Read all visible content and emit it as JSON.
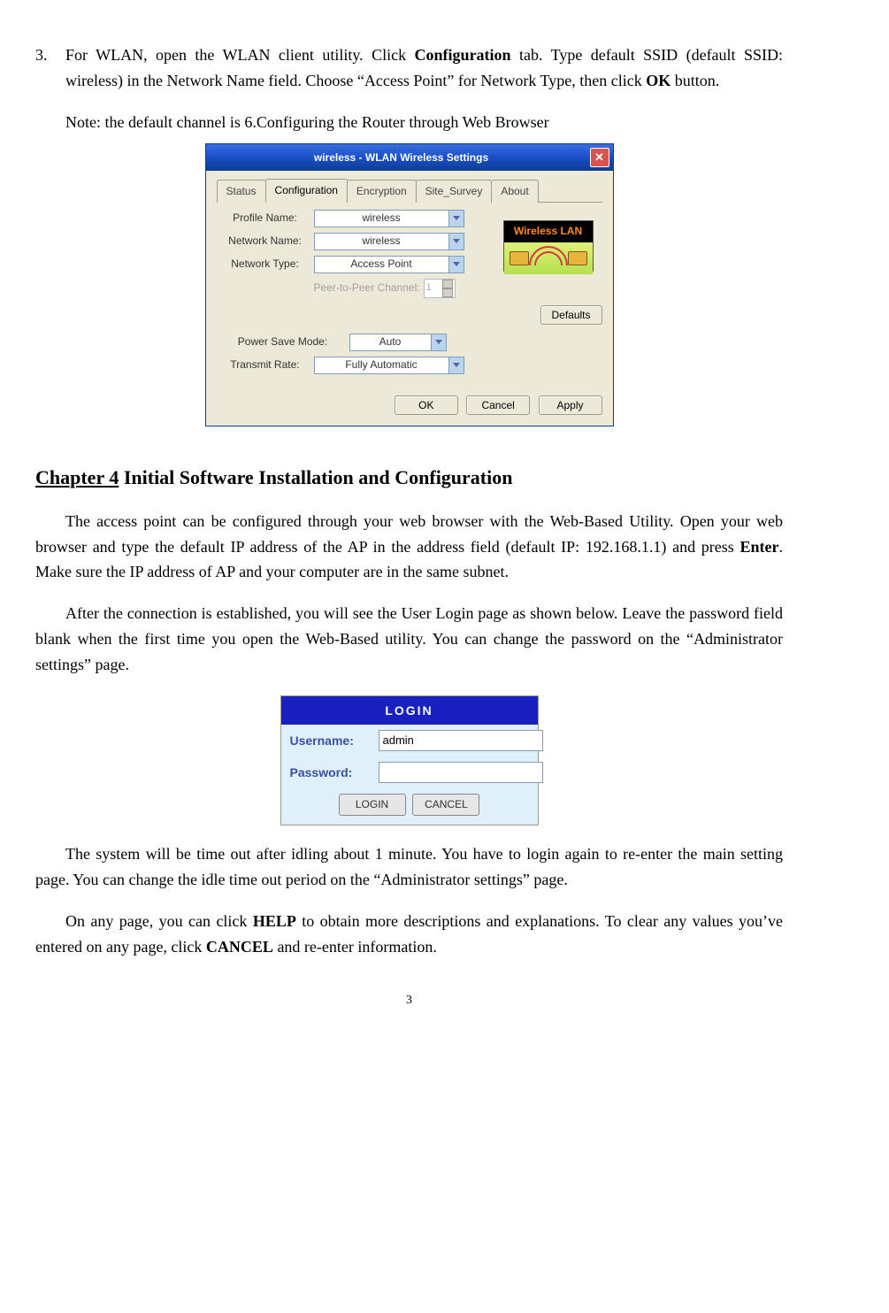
{
  "item3": {
    "number": "3.",
    "pre1": "For WLAN, open the WLAN client utility. Click ",
    "b1": "Configuration",
    "mid1": " tab. Type default SSID (default SSID: wireless) in the Network Name field. Choose “Access Point” for Network Type, then click ",
    "b2": "OK",
    "post1": " button.",
    "note": "Note: the default channel is 6.Configuring the Router through Web Browser"
  },
  "dlg": {
    "title": "wireless - WLAN Wireless Settings",
    "tabs": {
      "status": "Status",
      "config": "Configuration",
      "enc": "Encryption",
      "survey": "Site_Survey",
      "about": "About"
    },
    "logo": "Wireless LAN",
    "labels": {
      "profile": "Profile Name:",
      "network": "Network Name:",
      "ntype": "Network Type:",
      "p2p": "Peer-to-Peer Channel:",
      "psave": "Power Save Mode:",
      "trate": "Transmit Rate:"
    },
    "vals": {
      "profile": "wireless",
      "network": "wireless",
      "ntype": "Access Point",
      "p2p": "1",
      "psave": "Auto",
      "trate": "Fully Automatic"
    },
    "buttons": {
      "defaults": "Defaults",
      "ok": "OK",
      "cancel": "Cancel",
      "apply": "Apply"
    }
  },
  "chapter": {
    "num": "Chapter 4",
    "title": " Initial Software Installation and Configuration"
  },
  "p1": {
    "a": "The access point can be configured through your web browser with the Web-Based Utility. Open your web browser and type the default IP address of the AP in the address field (default IP: 192.168.1.1) and press ",
    "b": "Enter",
    "c": ". Make sure the IP address of AP and your computer are in the same subnet."
  },
  "p2": "After the connection is established, you will see the User Login page as shown below. Leave the password field blank when the first time you open the Web-Based utility. You can change the password on the “Administrator settings” page.",
  "login": {
    "header": "LOGIN",
    "user_lab": "Username:",
    "user_val": "admin",
    "pass_lab": "Password:",
    "btn_login": "LOGIN",
    "btn_cancel": "CANCEL"
  },
  "p3": "The system will be time out after idling about 1 minute. You have to login again to re-enter the main setting page. You can change the idle time out period on the “Administrator settings” page.",
  "p4": {
    "a": "On any page, you can click ",
    "b1": "HELP",
    "c": " to obtain more descriptions and explanations. To clear any values you’ve entered on any page, click ",
    "b2": "CANCEL",
    "d": " and re-enter information."
  },
  "pageno": "3"
}
